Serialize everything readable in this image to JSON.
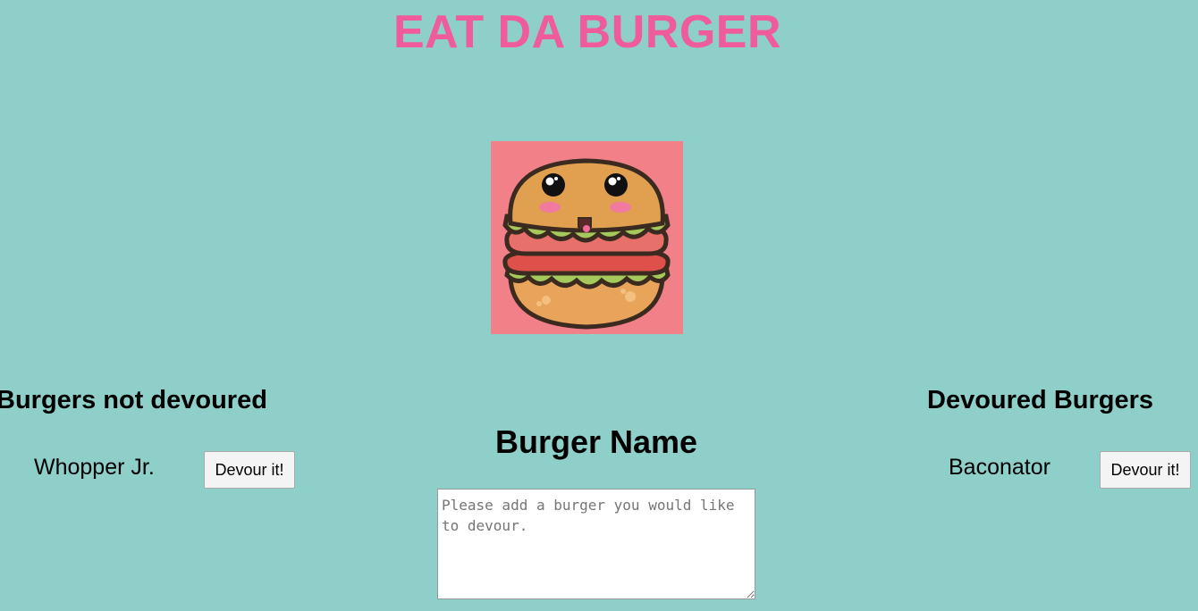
{
  "header": {
    "title": "EAT DA BURGER"
  },
  "logo": {
    "icon": "kawaii-burger-icon",
    "background": "#f28089"
  },
  "not_devoured": {
    "heading": "Burgers not devoured",
    "items": [
      {
        "name": "Whopper Jr.",
        "button_label": "Devour it!"
      }
    ]
  },
  "devoured": {
    "heading": "Devoured Burgers",
    "items": [
      {
        "name": "Baconator",
        "button_label": "Devour it!"
      }
    ]
  },
  "form": {
    "heading": "Burger Name",
    "input_value": "",
    "input_placeholder": "Please add a burger you would like to devour."
  },
  "colors": {
    "background": "#8ecfc9",
    "title": "#ef5b9b"
  }
}
